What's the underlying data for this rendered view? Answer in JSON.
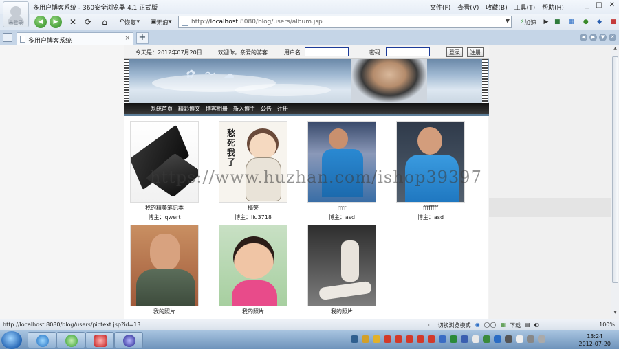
{
  "window": {
    "title": "多用户博客系统 - 360安全浏览器 4.1 正式版",
    "logo_caption": "未登录",
    "menu": [
      "文件(F)",
      "查看(V)",
      "收藏(B)",
      "工具(T)",
      "帮助(H)"
    ],
    "controls": [
      "_",
      "□",
      "✕"
    ]
  },
  "toolbar": {
    "back": "◀",
    "forward": "▶",
    "stop": "✕",
    "refresh": "⟳",
    "home": "⌂",
    "restore_label": "恢复",
    "no_trace_label": "无痕",
    "address_scheme": "http://",
    "address_host": "localhost",
    "address_rest": ":8080/blog/users/album.jsp",
    "accelerate_label": "加速"
  },
  "tabs": {
    "active_label": "多用户博客系统",
    "close": "×",
    "new": "+"
  },
  "site": {
    "today_label": "今天是：2012年07月20日",
    "welcome_label": "欢迎你，亲爱的游客",
    "username_label": "用户名:",
    "password_label": "密码:",
    "login_button": "登录",
    "register_button": "注册",
    "nav": [
      "系统首页",
      "精彩博文",
      "博客相册",
      "新入博主",
      "公告",
      "注册"
    ],
    "photos": [
      {
        "caption": "我的精美笔记本",
        "owner": "博主：qwert"
      },
      {
        "caption": "搞笑",
        "owner": "博主：liu3718",
        "art_text": "愁死我了"
      },
      {
        "caption": "rrrr",
        "owner": "博主：asd"
      },
      {
        "caption": "ffffffff",
        "owner": "博主：asd"
      },
      {
        "caption": "我的照片",
        "owner": ""
      },
      {
        "caption": "我的照片",
        "owner": ""
      },
      {
        "caption": "我的照片",
        "owner": ""
      }
    ]
  },
  "watermark": "https://www.huzhan.com/ishop39397",
  "status": {
    "url": "http://localhost:8080/blog/users/pictext.jsp?id=13",
    "mode_label": "切换浏览模式",
    "download_label": "下载",
    "zoom": "100%"
  },
  "taskbar": {
    "time": "13:24",
    "date": "2012-07-20"
  },
  "colors": {
    "accent": "#1c3b99",
    "navbar": "#1a1a1a",
    "tabbar": "#c5d5e7"
  }
}
